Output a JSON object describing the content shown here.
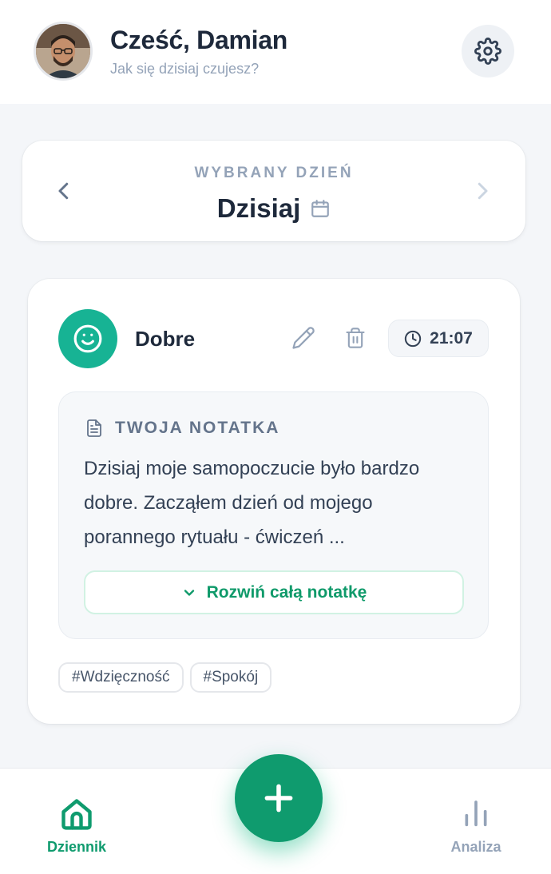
{
  "header": {
    "greeting": "Cześć, Damian",
    "subtitle": "Jak się dzisiaj czujesz?",
    "avatar_icon": "user-avatar",
    "settings_icon": "gear-icon"
  },
  "day_selector": {
    "label": "WYBRANY DZIEŃ",
    "value": "Dzisiaj",
    "prev_icon": "chevron-left-icon",
    "next_icon": "chevron-right-icon",
    "calendar_icon": "calendar-icon"
  },
  "entry": {
    "mood": "Dobre",
    "mood_icon": "smile-icon",
    "mood_color": "#17b394",
    "time": "21:07",
    "note": {
      "title": "TWOJA NOTATKA",
      "text": "Dzisiaj moje samopoczucie było bardzo dobre. Zacząłem dzień od mojego porannego rytuału - ćwiczeń ...",
      "expand_label": "Rozwiń całą notatkę"
    },
    "tags": [
      "#Wdzięczność",
      "#Spokój"
    ]
  },
  "bottom_nav": {
    "items": [
      {
        "label": "Dziennik",
        "icon": "home-icon",
        "active": true
      },
      {
        "label": "Analiza",
        "icon": "bar-chart-icon",
        "active": false
      }
    ],
    "fab_icon": "plus-icon",
    "accent": "#0f9b6e"
  }
}
